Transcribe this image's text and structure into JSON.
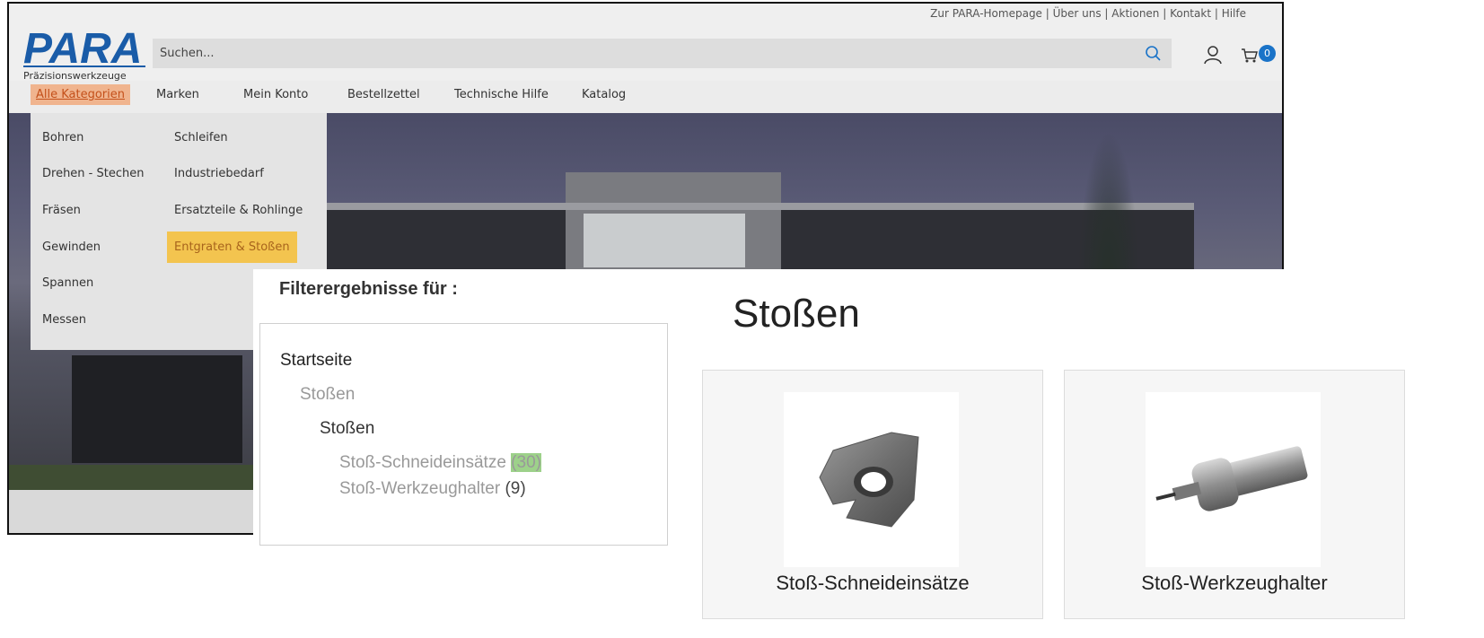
{
  "header": {
    "top_links": "Zur PARA-Homepage | Über uns | Aktionen | Kontakt | Hilfe",
    "logo_text": "PARA",
    "logo_subtitle": "Präzisionswerkzeuge",
    "search_placeholder": "Suchen...",
    "cart_count": "0"
  },
  "nav": {
    "items": [
      "Alle Kategorien",
      "Marken",
      "Mein Konto",
      "Bestellzettel",
      "Technische Hilfe",
      "Katalog"
    ]
  },
  "dropdown": {
    "left_column": [
      "Bohren",
      "Drehen - Stechen",
      "Fräsen",
      "Gewinden",
      "Spannen",
      "Messen"
    ],
    "right_column": [
      "Schleifen",
      "Industriebedarf",
      "Ersatzteile & Rohlinge",
      "Entgraten & Stoßen"
    ]
  },
  "filter": {
    "title": "Filterergebnisse für :",
    "tree": {
      "root": "Startseite",
      "level1": "Stoßen",
      "level2": "Stoßen",
      "items": [
        {
          "label": "Stoß-Schneideinsätze",
          "count": "(30)"
        },
        {
          "label": "Stoß-Werkzeughalter",
          "count": "(9)"
        }
      ]
    }
  },
  "main": {
    "title": "Stoßen",
    "cards": [
      {
        "label": "Stoß-Schneideinsätze",
        "image": "cutting-insert-image"
      },
      {
        "label": "Stoß-Werkzeughalter",
        "image": "tool-holder-image"
      }
    ]
  },
  "colors": {
    "brand_blue": "#1a5ca8",
    "nav_highlight": "#f0b48e",
    "dropdown_highlight": "#f3c44f",
    "count_highlight": "#9dd18a",
    "cart_badge": "#1a73c8"
  }
}
